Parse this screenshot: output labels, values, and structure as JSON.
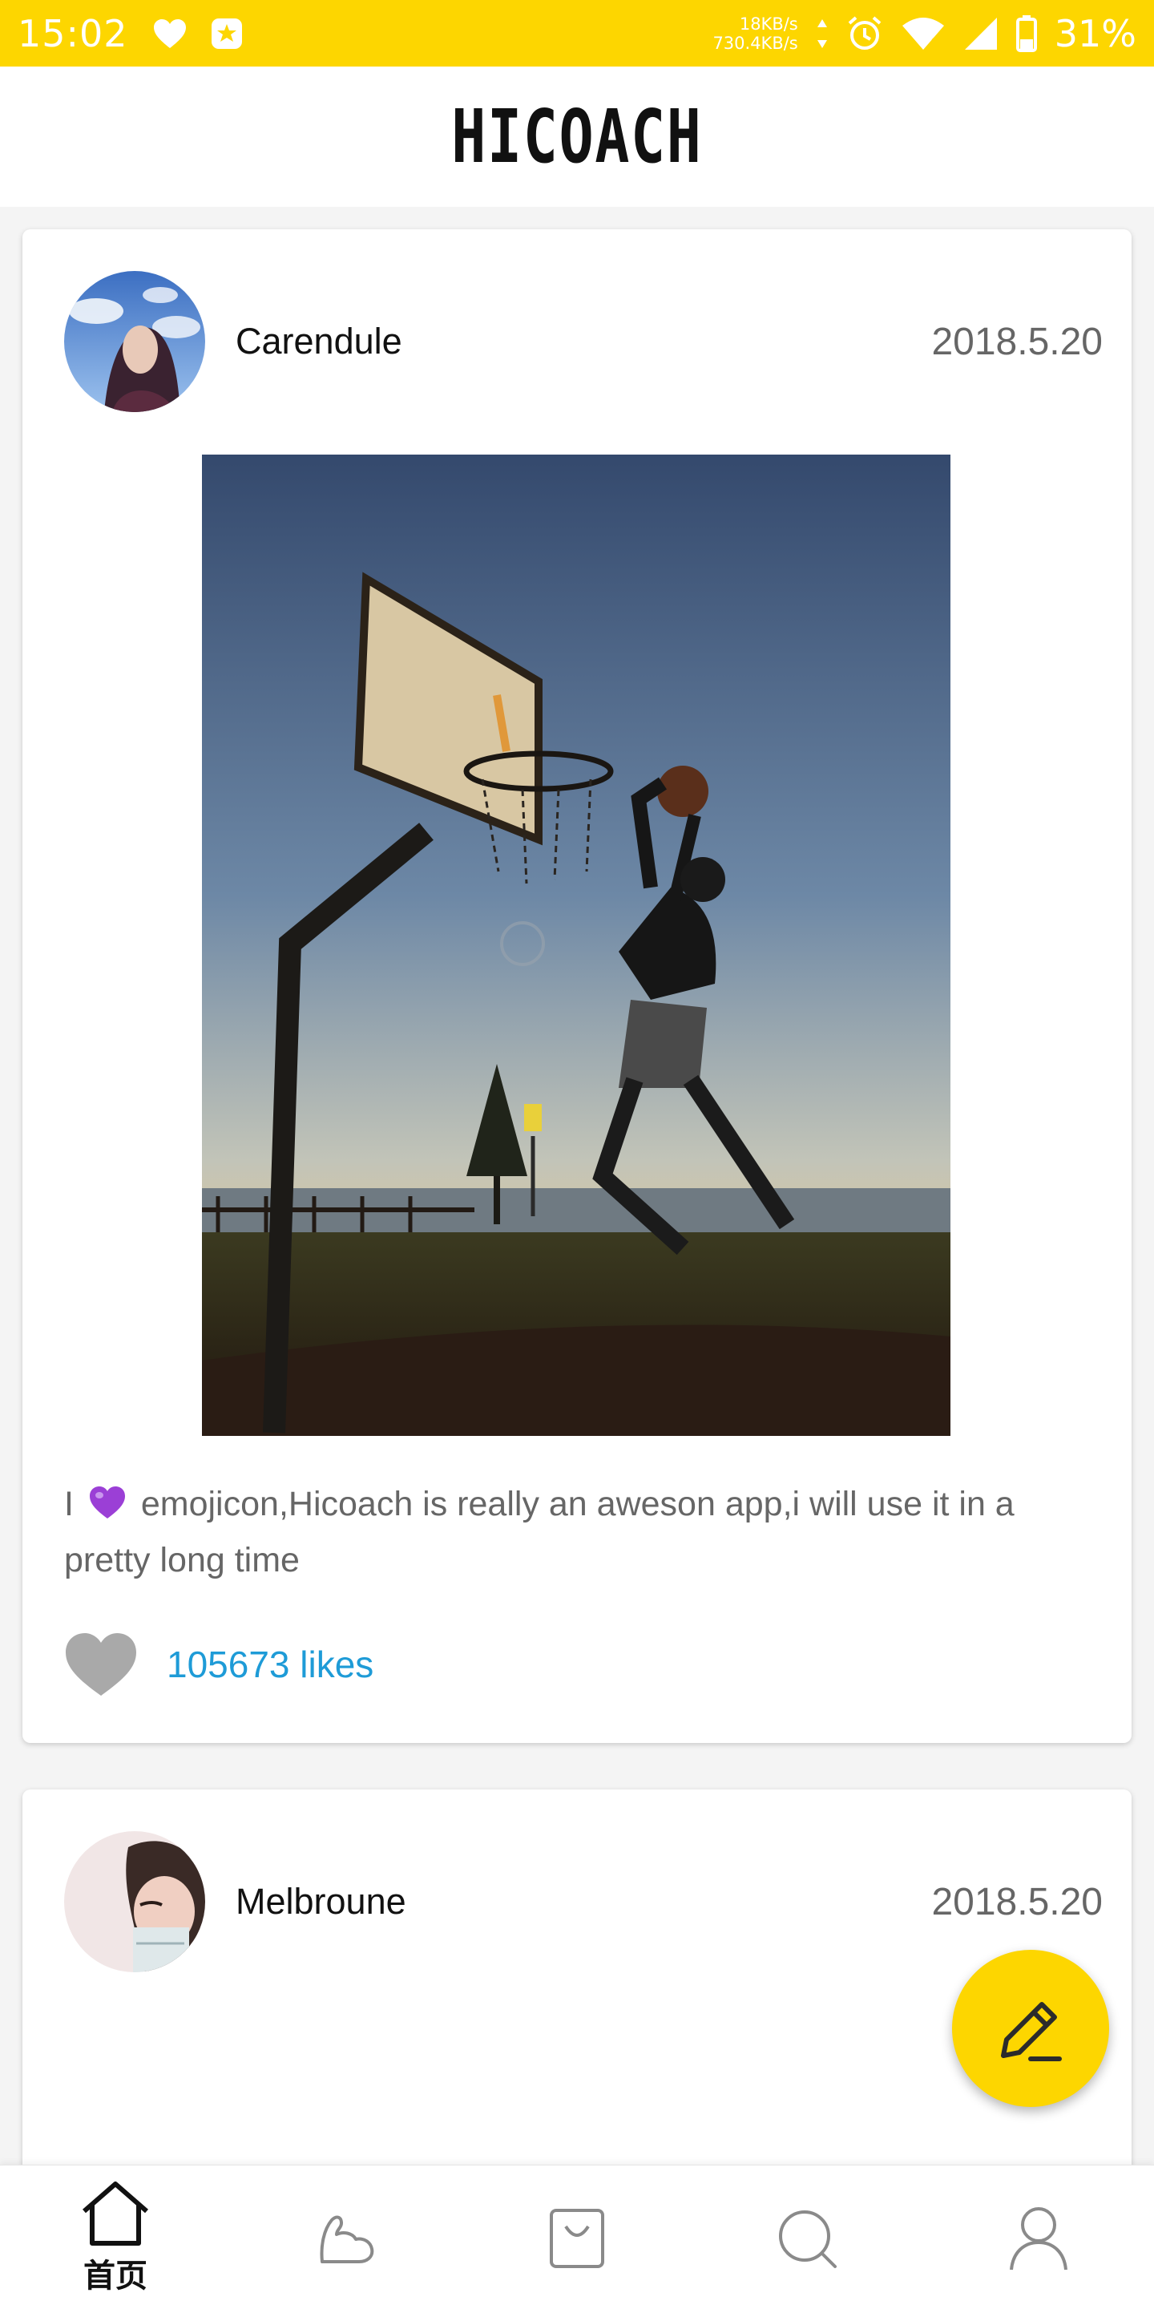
{
  "status_bar": {
    "time": "15:02",
    "net_up": "18KB/s",
    "net_down": "730.4KB/s",
    "battery": "31%",
    "icons": [
      "heart-icon",
      "app-notification-icon",
      "alarm-icon",
      "wifi-icon",
      "signal-icon",
      "battery-icon"
    ]
  },
  "app": {
    "title": "HICOACH",
    "accent": "#FDD600"
  },
  "posts": [
    {
      "username": "Carendule",
      "date": "2018.5.20",
      "caption_prefix": "I",
      "caption_text": "emojicon,Hicoach is really an aweson app,i will use it in a pretty long time",
      "likes": "105673 likes"
    },
    {
      "username": "Melbroune",
      "date": "2018.5.20"
    }
  ],
  "bottom_nav": {
    "items": [
      {
        "label": "首页",
        "icon": "home-icon",
        "active": true
      },
      {
        "label": "",
        "icon": "muscle-icon",
        "active": false
      },
      {
        "label": "",
        "icon": "shopping-bag-icon",
        "active": false
      },
      {
        "label": "",
        "icon": "search-icon",
        "active": false
      },
      {
        "label": "",
        "icon": "profile-icon",
        "active": false
      }
    ]
  },
  "colors": {
    "likes": "#1E9BD7",
    "status_bar": "#FDD600"
  }
}
